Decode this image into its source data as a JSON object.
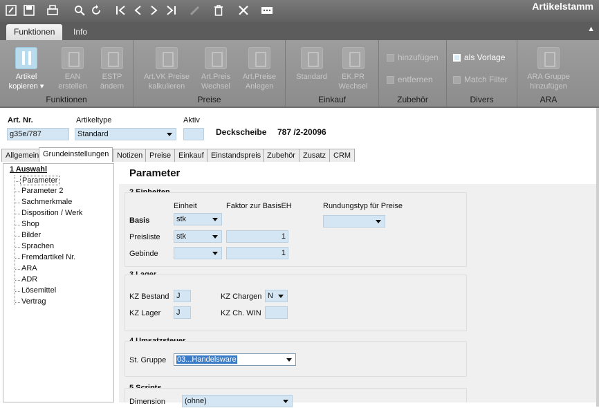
{
  "app": {
    "title": "Artikelstamm"
  },
  "toolbar_icons": [
    "edit-icon",
    "save-icon",
    "print-icon",
    "search-icon",
    "refresh-icon",
    "first-record-icon",
    "prev-record-icon",
    "next-record-icon",
    "last-record-icon",
    "pencil-icon",
    "trash-icon",
    "close-icon",
    "more-icon"
  ],
  "ribbon_tabs": [
    {
      "label": "Funktionen"
    },
    {
      "label": "Info"
    }
  ],
  "ribbon": {
    "groups": [
      "Funktionen",
      "Preise",
      "Einkauf",
      "Zubehör",
      "Divers",
      "ARA"
    ],
    "artikel_kopieren": "Artikel kopieren",
    "ean_erstellen": "EAN erstellen",
    "estp_aendern": "ESTP ändern",
    "art_vk_preise": "Art.VK Preise kalkulieren",
    "art_preis_wechsel": "Art.Preis Wechsel",
    "art_preise_anlegen": "Art.Preise Anlegen",
    "standard": "Standard",
    "ek_pr_wechsel": "EK.PR Wechsel",
    "hinzufuegen": "hinzufügen",
    "entfernen": "entfernen",
    "als_vorlage": "als Vorlage",
    "match_filter": "Match Filter",
    "ara_gruppe": "ARA Gruppe hinzufügen"
  },
  "header": {
    "art_nr_label": "Art. Nr.",
    "art_nr": "g35e/787",
    "artikeltype_label": "Artikeltype",
    "artikeltype": "Standard",
    "aktiv_label": "Aktiv",
    "aktiv": "",
    "bezeichnung": "Deckscheibe",
    "nummer": "787 /2-20096"
  },
  "tabs": [
    "Allgemein",
    "Grundeinstellungen",
    "Notizen",
    "Preise",
    "Einkauf",
    "Einstandspreis",
    "Zubehör",
    "Zusatz",
    "CRM"
  ],
  "tree": {
    "root": "1 Auswahl",
    "items": [
      "Parameter",
      "Parameter 2",
      "Sachmerkmale",
      "Disposition / Werk",
      "Shop",
      "Bilder",
      "Sprachen",
      "Fremdartikel Nr.",
      "ARA",
      "ADR",
      "Lösemittel",
      "Vertrag"
    ]
  },
  "parameter": {
    "title": "Parameter",
    "einheiten": {
      "title": "2 Einheiten",
      "col_einheit": "Einheit",
      "col_faktor": "Faktor zur BasisEH",
      "col_rundung": "Rundungstyp für Preise",
      "rows": [
        {
          "label": "Basis",
          "einheit": "stk",
          "faktor": ""
        },
        {
          "label": "Preisliste",
          "einheit": "stk",
          "faktor": "1"
        },
        {
          "label": "Gebinde",
          "einheit": "",
          "faktor": "1"
        }
      ],
      "rundung": ""
    },
    "lager": {
      "title": "3 Lager",
      "kz_bestand_label": "KZ Bestand",
      "kz_bestand": "J",
      "kz_chargen_label": "KZ Chargen",
      "kz_chargen": "N",
      "kz_lager_label": "KZ Lager",
      "kz_lager": "J",
      "kz_ch_win_label": "KZ Ch. WIN",
      "kz_ch_win": ""
    },
    "umsatzsteuer": {
      "title": "4 Umsatzsteuer",
      "st_gruppe_label": "St. Gruppe",
      "st_gruppe": "03...Handelsware"
    },
    "scripts": {
      "title": "5 Scripts",
      "dimension_label": "Dimension",
      "dimension": "(ohne)"
    }
  }
}
